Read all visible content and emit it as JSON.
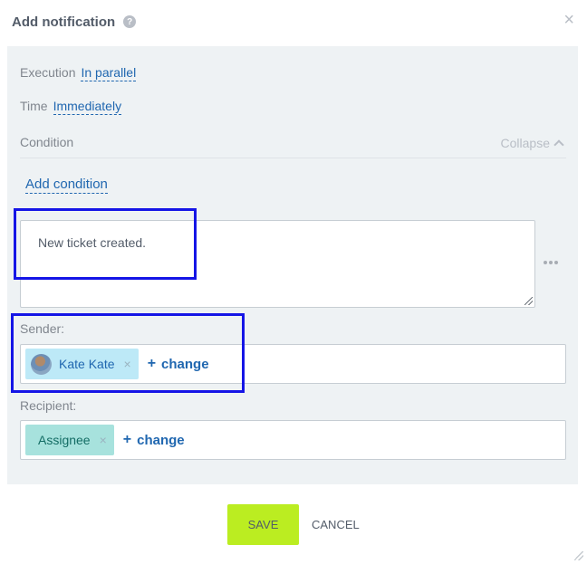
{
  "dialog": {
    "title": "Add notification",
    "help_icon": "?",
    "close_icon": "×"
  },
  "settings": {
    "execution_label": "Execution",
    "execution_value": "In parallel",
    "time_label": "Time",
    "time_value": "Immediately",
    "condition_label": "Condition",
    "collapse_label": "Collapse",
    "add_condition": "Add condition"
  },
  "message": {
    "text": "New ticket created."
  },
  "sender": {
    "label": "Sender:",
    "chip": "Kate Kate",
    "remove": "×",
    "change_plus": "+",
    "change": "change"
  },
  "recipient": {
    "label": "Recipient:",
    "chip": "Assignee",
    "remove": "×",
    "change_plus": "+",
    "change": "change"
  },
  "actions": {
    "save": "SAVE",
    "cancel": "CANCEL"
  },
  "colors": {
    "accent_link": "#2067b0",
    "save_button": "#bbed21",
    "sender_chip": "#bde9f7",
    "recipient_chip": "#a7e2dd",
    "highlight_box": "#1515e6"
  }
}
